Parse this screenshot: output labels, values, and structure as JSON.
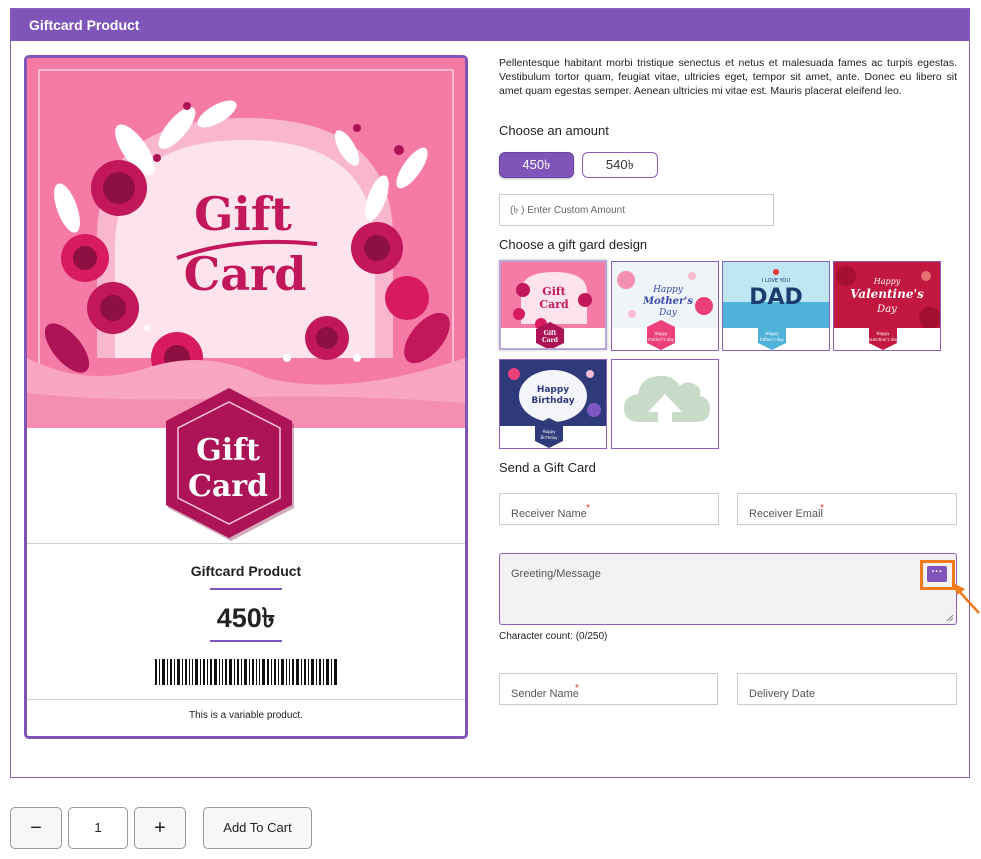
{
  "header": {
    "title": "Giftcard Product"
  },
  "preview": {
    "art_title_line1": "Gift",
    "art_title_line2": "Card",
    "badge_line1": "Gift",
    "badge_line2": "Card",
    "product_name": "Giftcard Product",
    "price": "450৳",
    "note": "This is a variable product."
  },
  "description": "Pellentesque habitant morbi tristique senectus et netus et malesuada fames ac turpis egestas. Vestibulum tortor quam, feugiat vitae, ultricies eget, tempor sit amet, ante. Donec eu libero sit amet quam egestas semper. Aenean ultricies mi vitae est. Mauris placerat eleifend leo.",
  "amount": {
    "label": "Choose an amount",
    "options": [
      "450৳",
      "540৳"
    ],
    "selected": "450৳",
    "custom_placeholder": "(৳ ) Enter Custom Amount"
  },
  "design": {
    "label": "Choose a gift gard design",
    "thumbnails": [
      {
        "name": "gift-card-pink",
        "title": "Gift Card",
        "badge": "Gift Card",
        "selected": true
      },
      {
        "name": "mothers-day",
        "title": "Happy Mother's Day",
        "badge": "Happy mother's day"
      },
      {
        "name": "fathers-day",
        "title": "I LOVE YOU DAD",
        "badge": "Happy father's day"
      },
      {
        "name": "valentines-day",
        "title": "Happy Valentine's Day",
        "badge": "Happy valentine's day"
      },
      {
        "name": "birthday",
        "title": "Happy Birthday",
        "badge": "Happy Birthday"
      },
      {
        "name": "upload-design",
        "icon": "cloud-upload-icon"
      }
    ]
  },
  "send": {
    "label": "Send a Gift Card",
    "receiver_name": "Receiver Name",
    "receiver_email": "Receiver Email",
    "message_placeholder": "Greeting/Message",
    "char_count": "Character count: (0/250)",
    "sender_name": "Sender Name",
    "delivery_date": "Delivery Date",
    "required_mark": "*",
    "more_button": "···"
  },
  "cart": {
    "minus": "−",
    "quantity": "1",
    "plus": "+",
    "add_label": "Add To Cart"
  },
  "colors": {
    "accent": "#7f55b9",
    "pink": "#f57aa5",
    "magenta": "#c2185b",
    "highlight": "#f07a1c"
  }
}
